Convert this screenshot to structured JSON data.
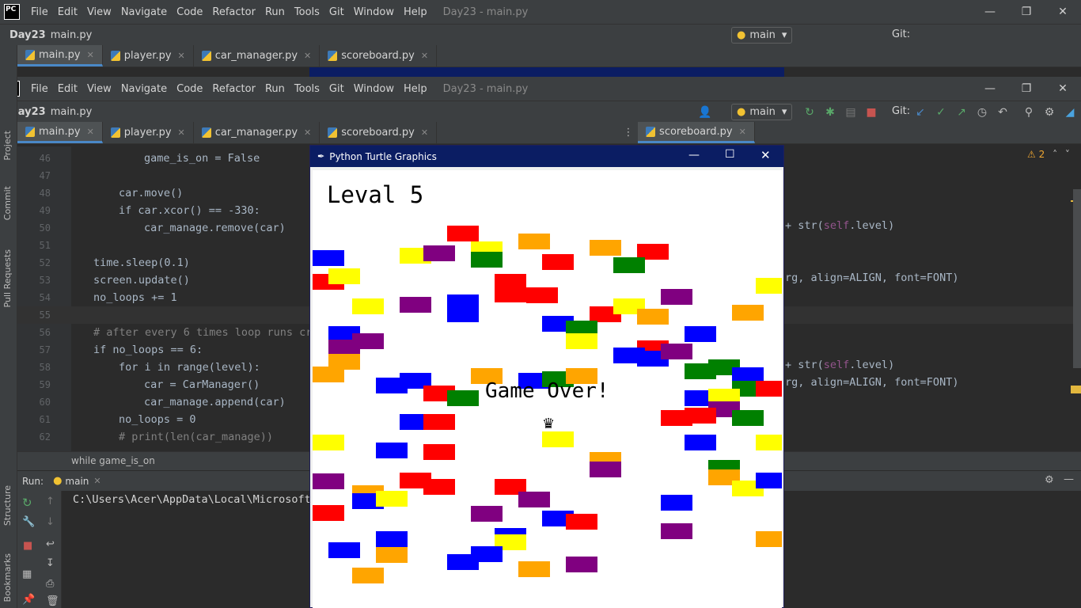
{
  "ide": {
    "logo": "PC",
    "menu": [
      "File",
      "Edit",
      "View",
      "Navigate",
      "Code",
      "Refactor",
      "Run",
      "Tools",
      "Git",
      "Window",
      "Help"
    ],
    "window_title": "Day23 - main.py",
    "breadcrumb_project": "Day23",
    "breadcrumb_file": "main.py",
    "branch": "main",
    "git_label": "Git:",
    "tabs_left": [
      "main.py",
      "player.py",
      "car_manager.py",
      "scoreboard.py"
    ],
    "tab_right": "scoreboard.py",
    "warnings_count": "2",
    "tool_windows_left": [
      "Project",
      "Commit",
      "Pull Requests",
      "Structure",
      "Bookmarks"
    ],
    "code_lines": [
      {
        "n": "46",
        "text": "game_is_on = False"
      },
      {
        "n": "47",
        "text": ""
      },
      {
        "n": "48",
        "text": "car.move()"
      },
      {
        "n": "49",
        "text": "if car.xcor() == -330:"
      },
      {
        "n": "50",
        "text": "car_manage.remove(car)"
      },
      {
        "n": "51",
        "text": ""
      },
      {
        "n": "52",
        "text": "time.sleep(0.1)"
      },
      {
        "n": "53",
        "text": "screen.update()"
      },
      {
        "n": "54",
        "text": "no_loops += 1"
      },
      {
        "n": "55",
        "text": ""
      },
      {
        "n": "56",
        "text": "# after every 6 times loop runs cr"
      },
      {
        "n": "57",
        "text": "if no_loops == 6:"
      },
      {
        "n": "58",
        "text": "for i in range(level):"
      },
      {
        "n": "59",
        "text": "car = CarManager()"
      },
      {
        "n": "60",
        "text": "car_manage.append(car)"
      },
      {
        "n": "61",
        "text": "no_loops = 0"
      },
      {
        "n": "62",
        "text": "# print(len(car_manage))"
      }
    ],
    "right_code": {
      "r1_a": "+ str(",
      "r1_b": "self",
      "r1_c": ".level)",
      "r2": "rg, align=ALIGN, font=FONT)",
      "r3_a": "+ str(",
      "r3_b": "self",
      "r3_c": ".level)",
      "r4": "rg, align=ALIGN, font=FONT)"
    },
    "status_context": "while game_is_on",
    "run_label": "Run:",
    "run_config": "main",
    "run_output": "C:\\Users\\Acer\\AppData\\Local\\Microsoft"
  },
  "turtle": {
    "title": "Python Turtle Graphics",
    "level_text": "Leval 5",
    "game_over_text": "Game Over!",
    "colors": {
      "red": "#ff0000",
      "yellow": "#ffff00",
      "blue": "#0000ff",
      "purple": "#800080",
      "orange": "#ffa500",
      "green": "#008000"
    }
  }
}
